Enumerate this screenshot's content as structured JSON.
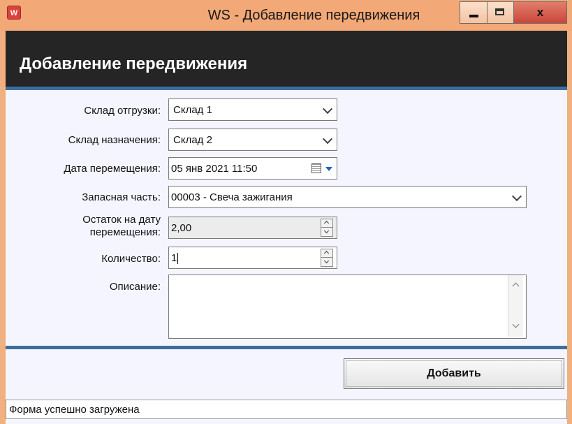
{
  "window": {
    "app_icon_letter": "W",
    "title": "WS - Добавление передвижения",
    "close_symbol": "x"
  },
  "header": {
    "title": "Добавление передвижения"
  },
  "form": {
    "source_warehouse": {
      "label": "Склад отгрузки:",
      "value": "Склад 1"
    },
    "destination_warehouse": {
      "label": "Склад назначения:",
      "value": "Склад 2"
    },
    "transfer_date": {
      "label": "Дата перемещения:",
      "value": "05 янв 2021 11:50"
    },
    "spare_part": {
      "label": "Запасная часть:",
      "value": "00003 - Свеча зажигания"
    },
    "stock_on_date": {
      "label_line1": "Остаток на дату",
      "label_line2": "перемещения:",
      "value": "2,00"
    },
    "quantity": {
      "label": "Количество:",
      "value": "1"
    },
    "description": {
      "label": "Описание:",
      "value": ""
    }
  },
  "actions": {
    "add_label": "Добавить"
  },
  "status": {
    "text": "Форма успешно загружена"
  },
  "colors": {
    "titlebar": "#f2a877",
    "banner": "#252525",
    "accent_rule": "#3c6e9e",
    "client_bg": "#f5f5ff"
  }
}
